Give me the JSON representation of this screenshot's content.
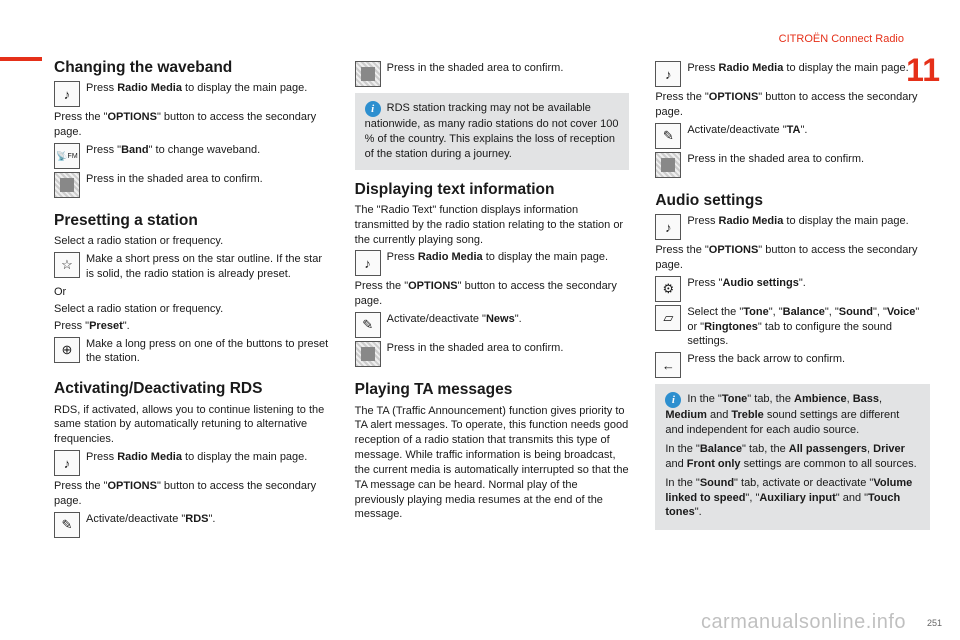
{
  "header": {
    "brand": "CITROËN Connect Radio",
    "chapter": "11",
    "page": "251"
  },
  "watermark": "carmanualsonline.info",
  "icons": {
    "music": "♪",
    "fm": "FM",
    "shade": "",
    "star": "☆",
    "plus": "⊕",
    "check": "✎",
    "gear": "⚙",
    "tone": "▱",
    "back": "←",
    "info": "i"
  },
  "col1": {
    "h_waveband": "Changing the waveband",
    "radio_media_main": "Press Radio Media to display the main page.",
    "options_secondary": "Press the \"OPTIONS\" button to access the secondary page.",
    "band": "Press \"Band\" to change waveband.",
    "press_shade": "Press in the shaded area to confirm.",
    "h_preset": "Presetting a station",
    "select_freq": "Select a radio station or frequency.",
    "star_press": "Make a short press on the star outline. If the star is solid, the radio station is already preset.",
    "or": "Or",
    "select_freq2": "Select a radio station or frequency.",
    "press_preset": "Press \"Preset\".",
    "long_press": "Make a long press on one of the buttons to preset the station.",
    "h_rds": "Activating/Deactivating RDS",
    "rds_intro": "RDS, if activated, allows you to continue listening to the same station by automatically retuning to alternative frequencies.",
    "rds_toggle": "Activate/deactivate \"RDS\"."
  },
  "col2": {
    "press_shade": "Press in the shaded area to confirm.",
    "rds_info": "RDS station tracking may not be available nationwide, as many radio stations do not cover 100 % of the country. This explains the loss of reception of the station during a journey.",
    "h_text": "Displaying text information",
    "text_intro": "The \"Radio Text\" function displays information transmitted by the radio station relating to the station or the currently playing song.",
    "radio_media_main": "Press Radio Media to display the main page.",
    "options_secondary": "Press the \"OPTIONS\" button to access the secondary page.",
    "news_toggle": "Activate/deactivate \"News\".",
    "press_shade2": "Press in the shaded area to confirm.",
    "h_ta": "Playing TA messages",
    "ta_body": "The TA (Traffic Announcement) function gives priority to TA alert messages. To operate, this function needs good reception of a radio station that transmits this type of message. While traffic information is being broadcast, the current media is automatically interrupted so that the TA message can be heard. Normal play of the previously playing media resumes at the end of the message."
  },
  "col3": {
    "radio_media_main": "Press Radio Media to display the main page.",
    "options_secondary": "Press the \"OPTIONS\" button to access the secondary page.",
    "ta_toggle": "Activate/deactivate \"TA\".",
    "press_shade": "Press in the shaded area to confirm.",
    "h_audio": "Audio settings",
    "radio_media_main2": "Press Radio Media to display the main page.",
    "options_secondary2": "Press the \"OPTIONS\" button to access the secondary page.",
    "audio_settings": "Press \"Audio settings\".",
    "tabs": "Select the \"Tone\", \"Balance\", \"Sound\", \"Voice\" or \"Ringtones\" tab to configure the sound settings.",
    "back": "Press the back arrow to confirm.",
    "info_tone_a": "In the \"Tone\" tab, the Ambience, Bass, Medium and Treble sound settings are different and independent for each audio source.",
    "info_balance": "In the \"Balance\" tab, the All passengers, Driver and Front only settings are common to all sources.",
    "info_sound": "In the \"Sound\" tab, activate or deactivate \"Volume linked to speed\", \"Auxiliary input\" and \"Touch tones\"."
  }
}
